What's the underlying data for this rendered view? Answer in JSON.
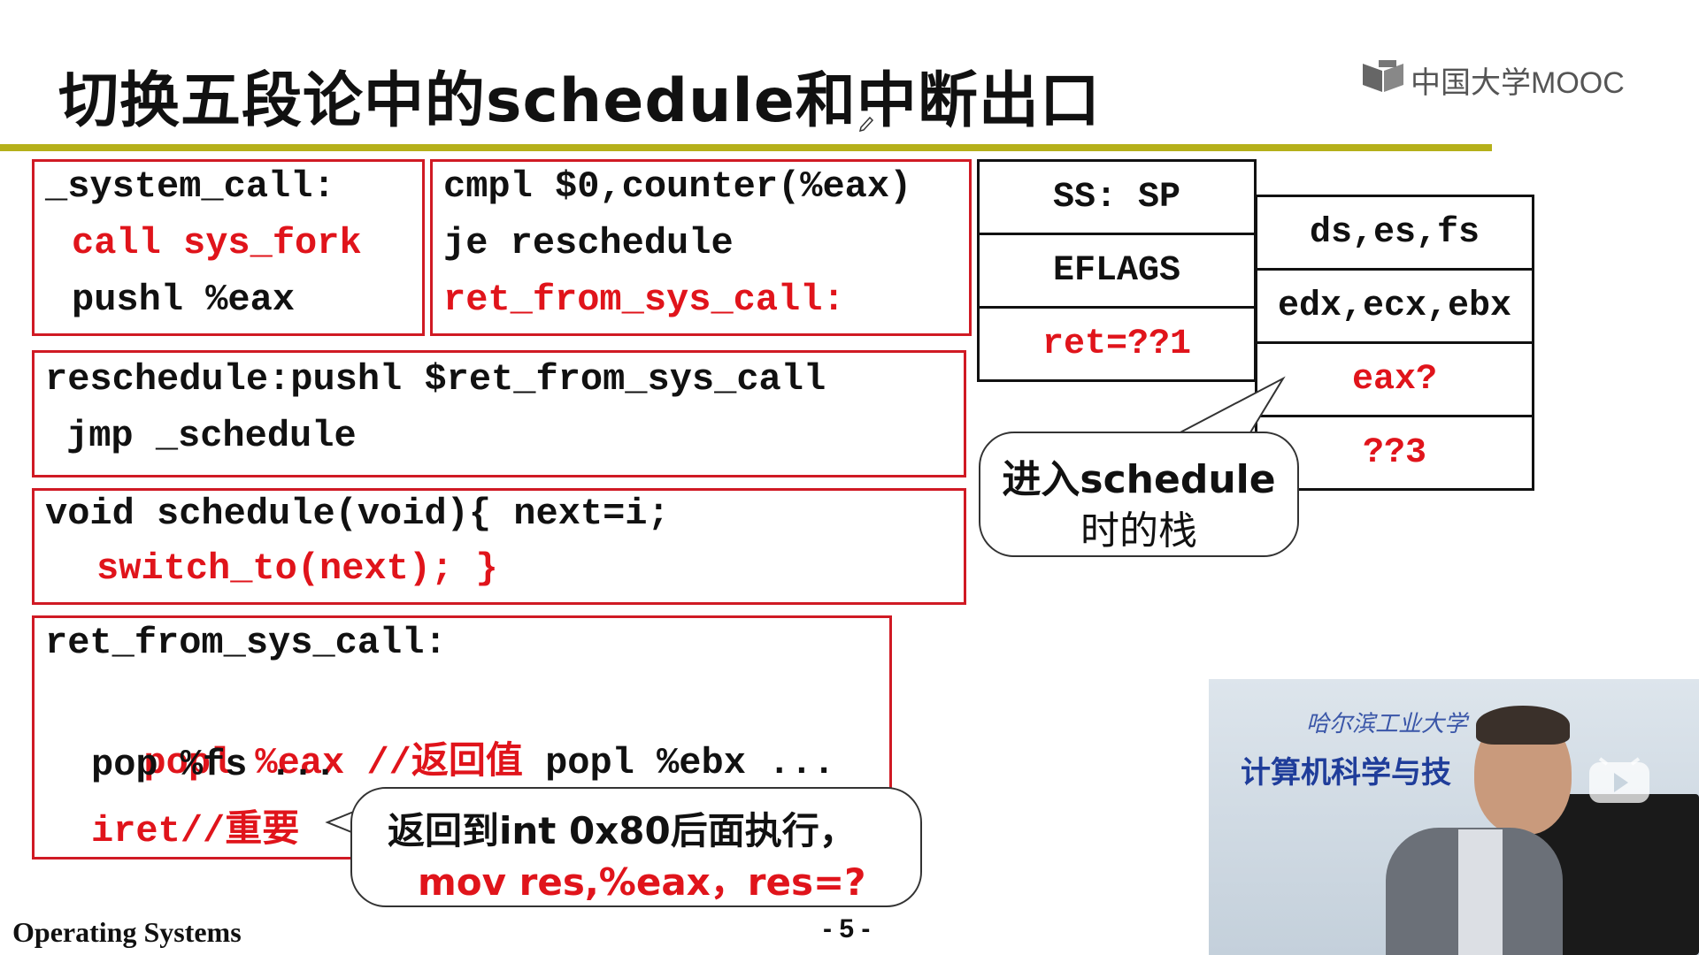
{
  "slide": {
    "title": "切换五段论中的schedule和中断出口",
    "logo_text": "中国大学MOOC",
    "footer": "Operating Systems",
    "page_number": "- 5 -"
  },
  "code": {
    "system_call": [
      "_system_call:",
      "call sys_fork",
      "pushl %eax"
    ],
    "cmpl": [
      "cmpl $0,counter(%eax)",
      "je reschedule",
      "ret_from_sys_call:"
    ],
    "reschedule": [
      "reschedule:pushl $ret_from_sys_call",
      "jmp _schedule"
    ],
    "schedule": [
      "void schedule(void){ next=i;",
      "switch_to(next); }"
    ],
    "ret_from": {
      "label": "ret_from_sys_call:",
      "line1_red": "popl %eax //返回值",
      "line1_black": " popl %ebx ...",
      "line2": "pop %fs ...",
      "line3": "iret//重要"
    }
  },
  "stack_left": [
    "SS: SP",
    "EFLAGS",
    "ret=??1"
  ],
  "stack_right": [
    "ds,es,fs",
    "edx,ecx,ebx",
    "eax?",
    "??3"
  ],
  "callouts": {
    "schedule_stack": [
      "进入schedule",
      "时的栈"
    ],
    "return_note": [
      "返回到int 0x80后面执行，",
      "mov res,%eax，res=?"
    ]
  },
  "video": {
    "banner_text": "计算机科学与技",
    "school_text": "哈尔滨工业大学"
  },
  "colors": {
    "code_red": "#e0141b",
    "title_rule": "#b5b01a",
    "box_border": "#d01a24"
  },
  "icons": [
    "mooc-logo-icon",
    "play-icon",
    "pen-cursor-icon"
  ]
}
